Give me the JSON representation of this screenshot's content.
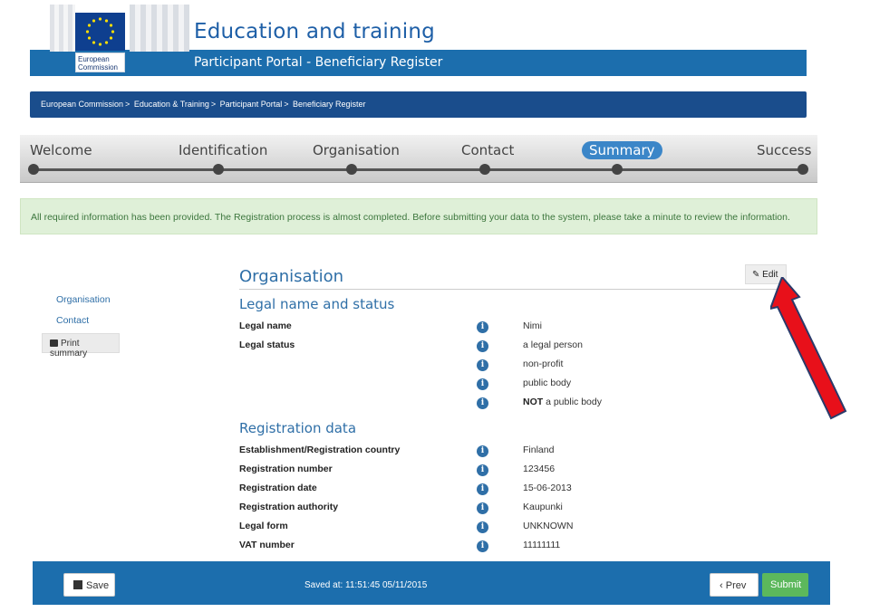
{
  "header": {
    "title": "Education and training",
    "subtitle": "Participant Portal - Beneficiary Register",
    "logo_text_line1": "European",
    "logo_text_line2": "Commission",
    "flag_color": "#0e3f8f",
    "bar_color": "#1c6ead"
  },
  "breadcrumb": [
    "European Commission",
    "Education & Training",
    "Participant Portal",
    "Beneficiary Register"
  ],
  "breadcrumb_sep": ">",
  "steps": [
    {
      "label": "Welcome",
      "active": false
    },
    {
      "label": "Identification",
      "active": false
    },
    {
      "label": "Organisation",
      "active": false
    },
    {
      "label": "Contact",
      "active": false
    },
    {
      "label": "Summary",
      "active": true
    },
    {
      "label": "Success",
      "active": false
    }
  ],
  "alert": {
    "text": "All required information has been provided. The Registration process is almost completed. Before submitting your data to the system, please take a minute to review the information."
  },
  "sidebar": {
    "links": [
      "Organisation",
      "Contact"
    ],
    "print_label": "Print summary",
    "print_icon": "printer-icon"
  },
  "main": {
    "section_title": "Organisation",
    "edit_label": "Edit",
    "edit_icon": "pencil-icon",
    "legal": {
      "title": "Legal name and status",
      "rows": [
        {
          "label": "Legal name",
          "value": "Nimi"
        },
        {
          "label": "Legal status",
          "value": "a legal person"
        },
        {
          "label": "",
          "value": "non-profit"
        },
        {
          "label": "",
          "value": "public body"
        },
        {
          "label": "",
          "value_bold": "NOT",
          "value": " a public body"
        }
      ]
    },
    "registration": {
      "title": "Registration data",
      "rows": [
        {
          "label": "Establishment/Registration country",
          "value": "Finland"
        },
        {
          "label": "Registration number",
          "value": "123456"
        },
        {
          "label": "Registration date",
          "value": "15-06-2013"
        },
        {
          "label": "Registration authority",
          "value": "Kaupunki"
        },
        {
          "label": "Legal form",
          "value": "UNKNOWN"
        },
        {
          "label": "VAT number",
          "value": "11111111"
        }
      ]
    },
    "info_icon": "info-icon",
    "annotation_arrow_color": "#e8101a"
  },
  "footer": {
    "save_label": "Save",
    "save_icon": "floppy-disk-icon",
    "saved_text": "Saved at: 11:51:45 05/11/2015",
    "prev_label": "Prev",
    "prev_icon": "chevron-left-icon",
    "submit_label": "Submit",
    "submit_color": "#5cb85c"
  }
}
